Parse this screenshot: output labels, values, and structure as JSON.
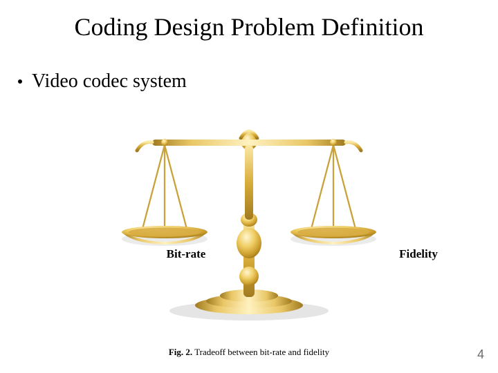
{
  "title": "Coding Design Problem Definition",
  "bullet": "Video codec system",
  "figure": {
    "left_label": "Bit-rate",
    "right_label": "Fidelity",
    "fig_number": "Fig. 2.",
    "caption": "Tradeoff between bit-rate and fidelity"
  },
  "page_number": "4"
}
